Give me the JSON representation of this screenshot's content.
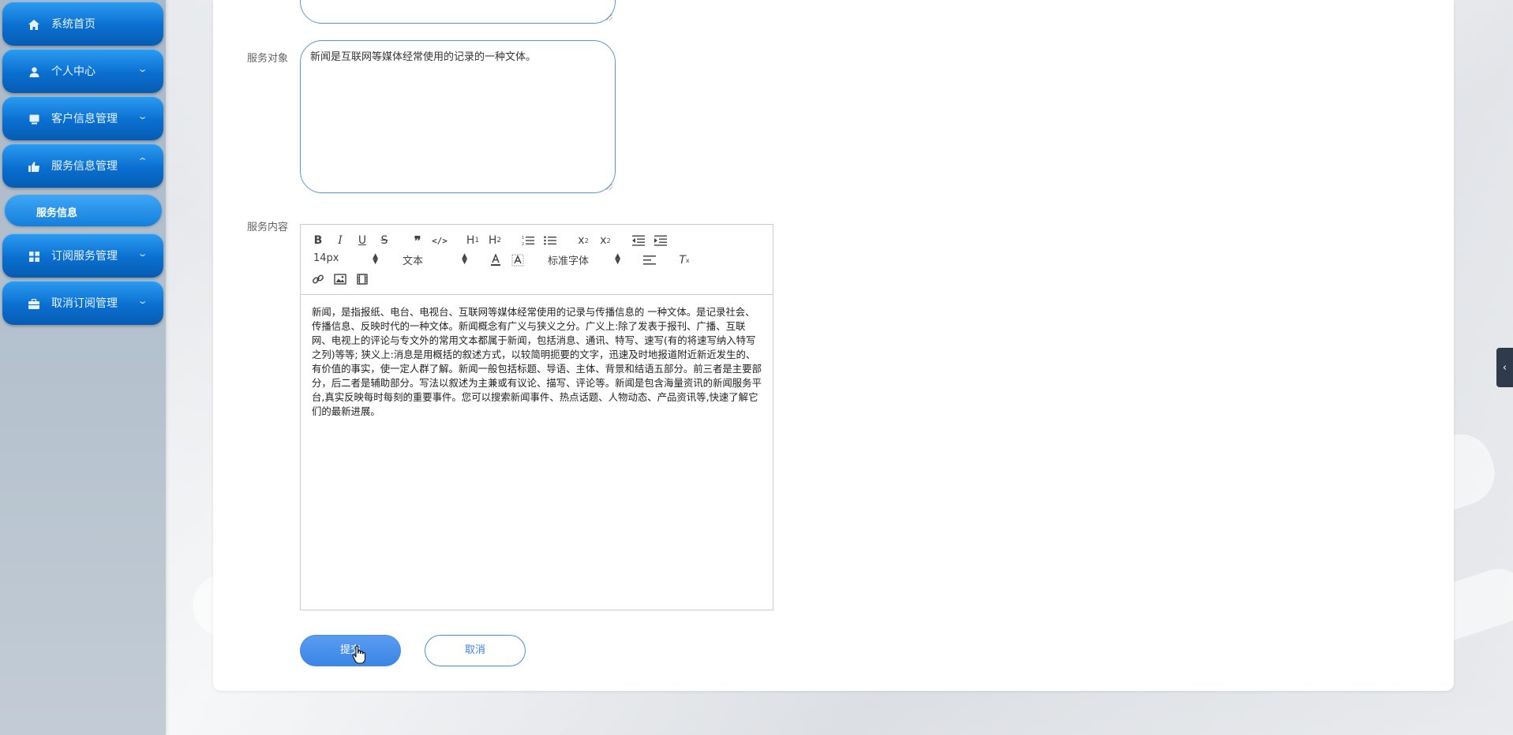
{
  "sidebar": {
    "items": [
      {
        "label": "系统首页",
        "icon": "home-icon",
        "expandable": false
      },
      {
        "label": "个人中心",
        "icon": "user-icon",
        "expandable": true,
        "expanded": false
      },
      {
        "label": "客户信息管理",
        "icon": "monitor-icon",
        "expandable": true,
        "expanded": false
      },
      {
        "label": "服务信息管理",
        "icon": "thumbs-up-icon",
        "expandable": true,
        "expanded": true
      },
      {
        "label": "订阅服务管理",
        "icon": "grid-icon",
        "expandable": true,
        "expanded": false
      },
      {
        "label": "取消订阅管理",
        "icon": "briefcase-icon",
        "expandable": true,
        "expanded": false
      }
    ],
    "active_sub_item": "服务信息"
  },
  "form": {
    "service_target_label": "服务对象",
    "service_target_value": "新闻是互联网等媒体经常使用的记录的一种文体。",
    "service_content_label": "服务内容",
    "editor": {
      "font_size": "14px",
      "block_type": "文本",
      "font_family": "标准字体",
      "content": "新闻，是指报纸、电台、电视台、互联网等媒体经常使用的记录与传播信息的 一种文体。是记录社会、传播信息、反映时代的一种文体。新闻概念有广义与狭义之分。广义上:除了发表于报刊、广播、互联网、电视上的评论与专文外的常用文本都属于新闻，包括消息、通讯、特写、速写(有的将速写纳入特写之列)等等; 狭义上:消息是用概括的叙述方式，以较简明扼要的文字，迅速及时地报道附近新近发生的、有价值的事实，使一定人群了解。新闻一般包括标题、导语、主体、背景和结语五部分。前三者是主要部分，后二者是辅助部分。写法以叙述为主兼或有议论、描写、评论等。新闻是包含海量资讯的新闻服务平台,真实反映每时每刻的重要事件。您可以搜索新闻事件、热点话题、人物动态、产品资讯等,快速了解它们的最新进展。"
    },
    "submit_label": "提交",
    "cancel_label": "取消"
  },
  "colors": {
    "menu_blue": "#0a6fd0",
    "accent": "#3a85e6",
    "sidebar_bg": "#b7c3cf"
  }
}
